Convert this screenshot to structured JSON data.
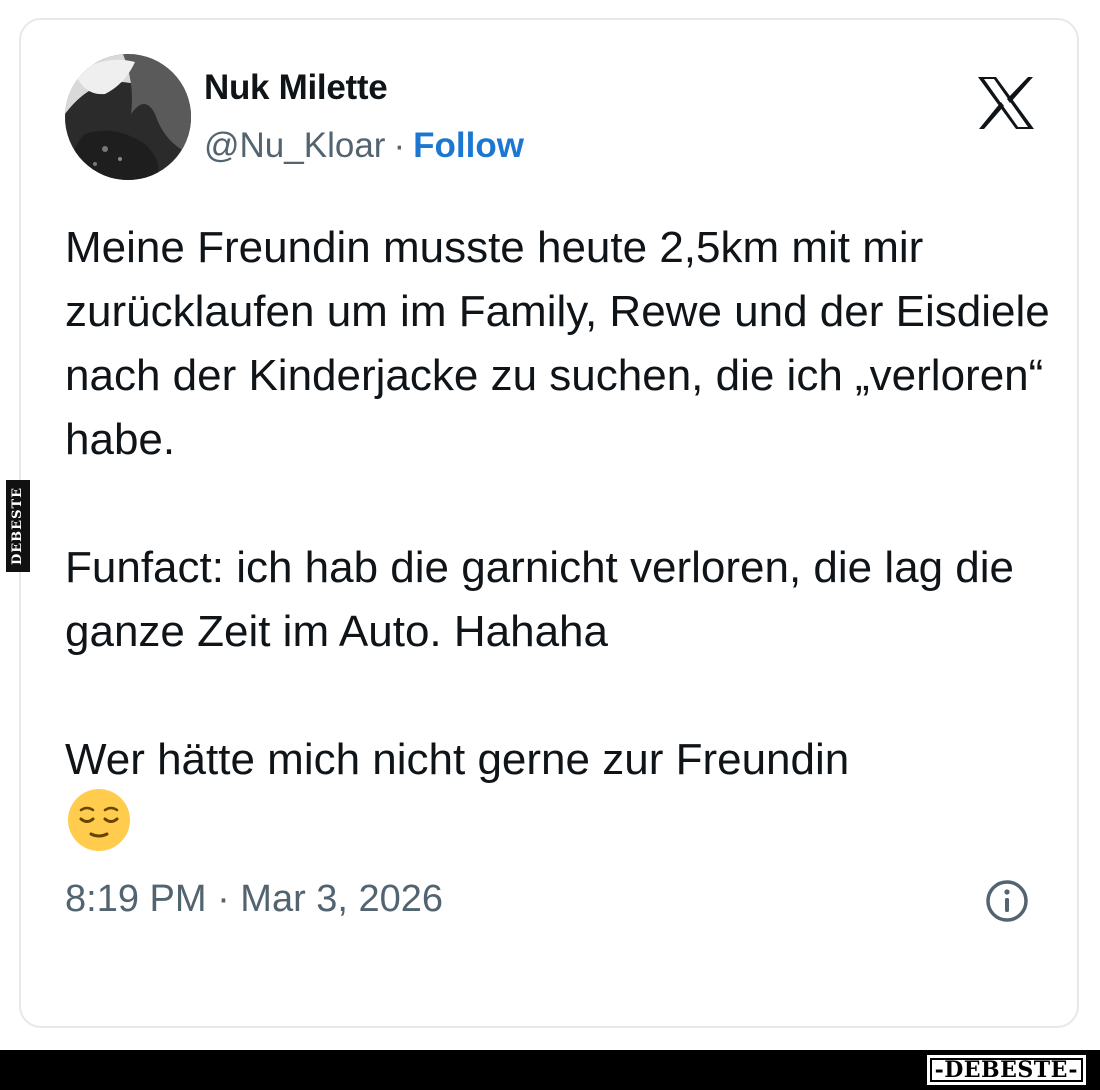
{
  "author": {
    "display_name": "Nuk Milette",
    "handle": "@Nu_Kloar",
    "separator": "·",
    "follow_label": "Follow",
    "avatar_icon": "profile-photo-avatar"
  },
  "platform": {
    "logo_icon": "x-logo-icon"
  },
  "tweet": {
    "paragraphs": [
      "Meine Freundin musste heute 2,5km mit mir zurücklaufen um im Family, Rewe und der Eisdiele nach der Kinderjacke zu suchen, die ich „verloren“ habe.",
      "Funfact: ich hab die garnicht verloren, die lag die ganze Zeit im Auto. Hahaha",
      "Wer hätte mich nicht gerne zur Freundin"
    ],
    "emoji_icon": "relieved-face-emoji",
    "timestamp": "8:19 PM · Mar 3, 2026",
    "info_icon": "info-circle-icon"
  },
  "watermark": {
    "side_text": "DEBESTE",
    "brand_text": "-DEBESTE-"
  },
  "colors": {
    "text": "#0f1419",
    "muted": "#536471",
    "follow": "#1d77d1",
    "emoji": "#ffcc4d"
  }
}
